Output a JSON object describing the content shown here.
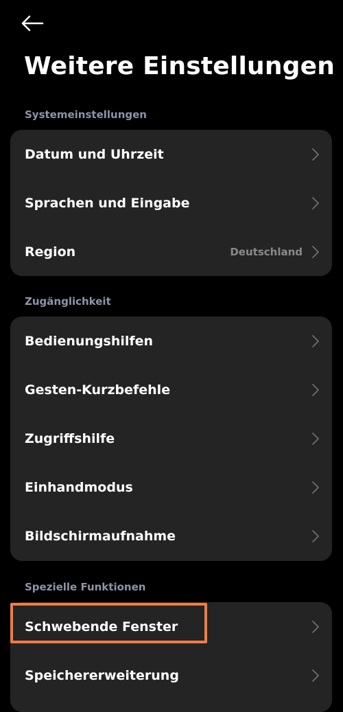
{
  "header": {
    "back_icon": "arrow-left-icon",
    "title": "Weitere Einstellungen"
  },
  "sections": [
    {
      "title": "Systemeinstellungen",
      "items": [
        {
          "label": "Datum und Uhrzeit",
          "value": ""
        },
        {
          "label": "Sprachen und Eingabe",
          "value": ""
        },
        {
          "label": "Region",
          "value": "Deutschland"
        }
      ]
    },
    {
      "title": "Zugänglichkeit",
      "items": [
        {
          "label": "Bedienungshilfen",
          "value": ""
        },
        {
          "label": "Gesten-Kurzbefehle",
          "value": ""
        },
        {
          "label": "Zugriffshilfe",
          "value": ""
        },
        {
          "label": "Einhandmodus",
          "value": ""
        },
        {
          "label": "Bildschirmaufnahme",
          "value": ""
        }
      ]
    },
    {
      "title": "Spezielle Funktionen",
      "items": [
        {
          "label": "Schwebende Fenster",
          "value": ""
        },
        {
          "label": "Speichererweiterung",
          "value": ""
        }
      ]
    }
  ],
  "icons": {
    "row_chevron": "chevron-right-icon"
  },
  "colors": {
    "background": "#000000",
    "card": "#242424",
    "section_header": "#8e93a8",
    "value_text": "#8a8a8a",
    "chevron": "#6f6f6f",
    "highlight": "#f47b46"
  }
}
